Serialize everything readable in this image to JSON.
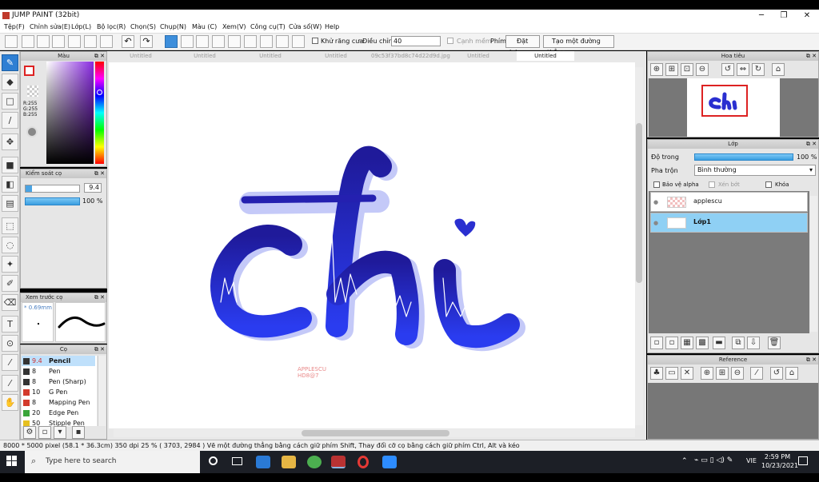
{
  "window": {
    "title": "JUMP PAINT (32bit)",
    "controls": [
      "─",
      "❐",
      "✕"
    ]
  },
  "menu": [
    "Tệp(F)",
    "Chỉnh sửa(E)",
    "Lớp(L)",
    "Bộ lọc(R)",
    "Chọn(S)",
    "Chụp(N)",
    "Màu (C)",
    "Xem(V)",
    "Công cụ(T)",
    "Cửa sổ(W)",
    "Help"
  ],
  "toolbar": {
    "antialias_label": "Khử răng cưa",
    "adjust_label": "Điều chỉnh",
    "adjust_value": "40",
    "edge_label": "Cạnh mềm",
    "key_label": "Phím",
    "reset_label": "Đặt lại",
    "new_line_label": "Tạo một đường thẳng"
  },
  "tabs": [
    "Untitled",
    "Untitled",
    "Untitled",
    "Untitled",
    "09c53f37bd8c74d22d9d.jpg",
    "Untitled",
    "Untitled"
  ],
  "color_panel": {
    "title": "Màu",
    "r": "R:255",
    "g": "G:255",
    "b": "B:255"
  },
  "brush_control": {
    "title": "Kiểm soát cọ",
    "size": "9.4",
    "opacity": "100 %"
  },
  "preview": {
    "title": "Xem trước cọ",
    "size": "* 0.69mm"
  },
  "brushes": {
    "title": "Cọ",
    "items": [
      {
        "size": "9.4",
        "name": "Pencil",
        "color": "#333333"
      },
      {
        "size": "8",
        "name": "Pen",
        "color": "#333333"
      },
      {
        "size": "8",
        "name": "Pen (Sharp)",
        "color": "#333333"
      },
      {
        "size": "10",
        "name": "G Pen",
        "color": "#d33a2c"
      },
      {
        "size": "8",
        "name": "Mapping Pen",
        "color": "#d33a2c"
      },
      {
        "size": "20",
        "name": "Edge Pen",
        "color": "#3aa53a"
      },
      {
        "size": "50",
        "name": "Stipple Pen",
        "color": "#e6c020"
      }
    ]
  },
  "artwork": {
    "text": "chi",
    "watermark_1": "APPLESCU",
    "watermark_2": "HD8@7",
    "accent": "#2a2fd0",
    "shadow": "#b9bff5"
  },
  "navigator": {
    "title": "Hoa tiêu"
  },
  "layers": {
    "title": "Lớp",
    "opacity_label": "Độ trong",
    "opacity_value": "100 %",
    "blend_label": "Pha trộn",
    "blend_value": "Bình thường",
    "protect_alpha": "Bảo vệ alpha",
    "clip": "Xén bớt",
    "lock": "Khóa",
    "items": [
      {
        "name": "applescu",
        "selected": false
      },
      {
        "name": "Lớp1",
        "selected": true
      }
    ]
  },
  "reference": {
    "title": "Reference"
  },
  "status": "8000 * 5000 pixel  (58.1 * 36.3cm)  350 dpi  25 %  ( 3703, 2984 )  Vẽ một đường thẳng bằng cách giữ phím Shift, Thay đổi cỡ cọ bằng cách giữ phím Ctrl, Alt và kéo",
  "taskbar": {
    "search_placeholder": "Type here to search",
    "lang": "VIE",
    "time": "2:59 PM",
    "date": "10/23/2021"
  }
}
